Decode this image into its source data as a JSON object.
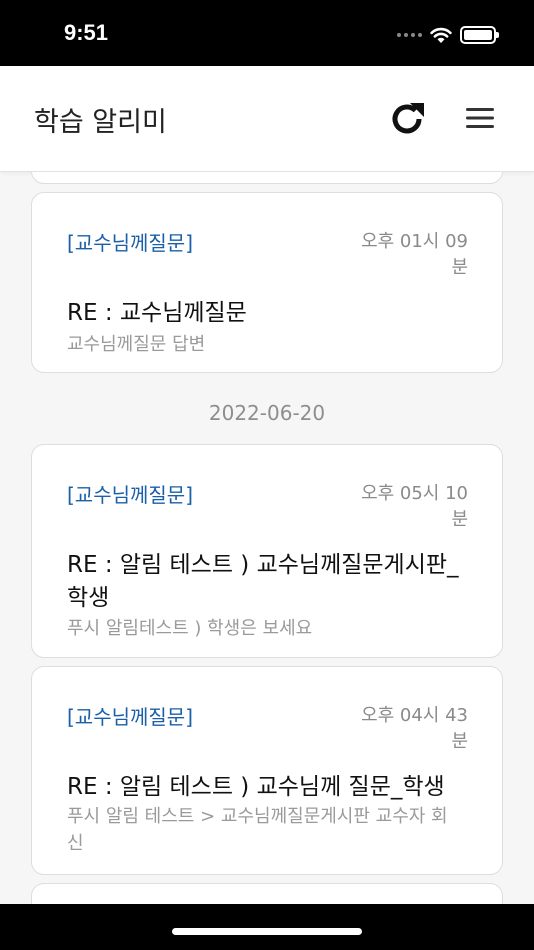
{
  "status_bar": {
    "time": "9:51"
  },
  "header": {
    "title": "학습 알리미",
    "refresh_icon": "refresh-icon",
    "menu_icon": "hamburger-menu-icon"
  },
  "cards": [
    {
      "category": "[교수님께질문]",
      "time": "오후 01시 09분",
      "title": "RE : 교수님께질문",
      "body": "교수님께질문 답변"
    },
    {
      "category": "[교수님께질문]",
      "time": "오후 05시 10분",
      "title": "RE : 알림 테스트 ) 교수님께질문게시판_ 학생",
      "body": "푸시 알림테스트 ) 학생은 보세요"
    },
    {
      "category": "[교수님께질문]",
      "time": "오후 04시 43분",
      "title": "RE : 알림 테스트 ) 교수님께 질문_학생",
      "body": "푸시 알림 테스트 > 교수님께질문게시판 교수자 회신"
    }
  ],
  "date_dividers": [
    "2022-06-20"
  ],
  "colors": {
    "category": "#1a5fa8",
    "background": "#f6f6f6"
  }
}
